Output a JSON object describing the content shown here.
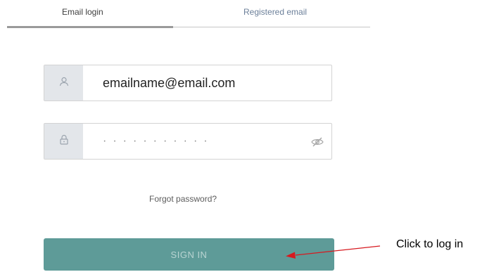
{
  "tabs": {
    "login_label": "Email login",
    "register_label": "Registered email",
    "active": "Email login"
  },
  "email_field": {
    "value": "emailname@email.com",
    "icon": "user-icon"
  },
  "password_field": {
    "masked_value": "···········",
    "icon": "lock-icon",
    "toggle_icon": "eye-slash-icon"
  },
  "forgot_password": {
    "label": "Forgot password?"
  },
  "sign_in": {
    "label": "SIGN IN"
  },
  "annotation": {
    "text": "Click to log in",
    "color": "#d7191f"
  },
  "colors": {
    "button": "#5e9b98",
    "button_text": "#b9d4d2",
    "icon_box": "#e3e6ea"
  }
}
